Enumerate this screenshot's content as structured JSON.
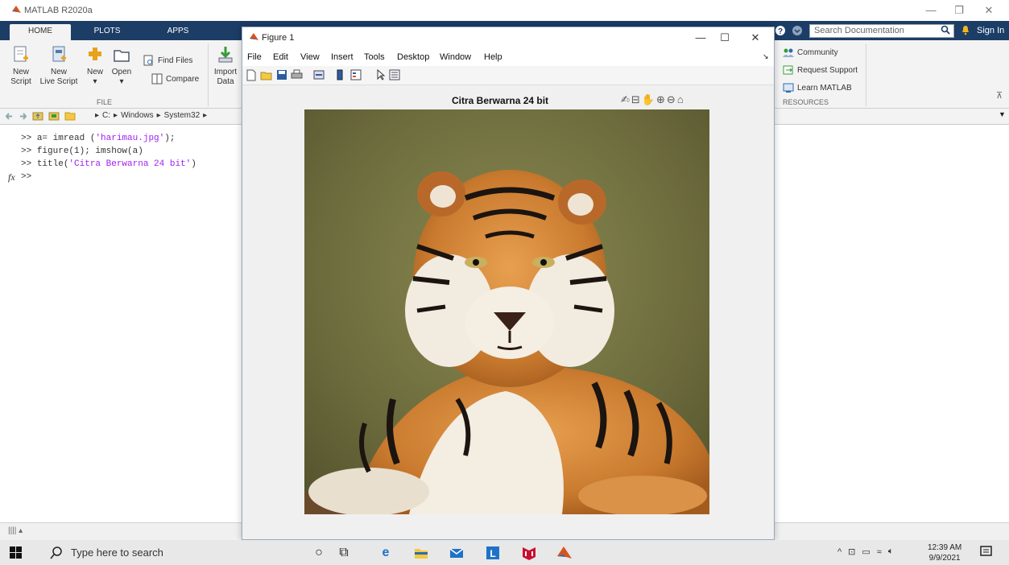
{
  "app": {
    "title": "MATLAB R2020a",
    "window_controls": {
      "minimize": "—",
      "restore": "❐",
      "close": "✕"
    }
  },
  "tabs": [
    {
      "label": "HOME",
      "active": true
    },
    {
      "label": "PLOTS",
      "active": false
    },
    {
      "label": "APPS",
      "active": false
    }
  ],
  "search": {
    "placeholder": "Search Documentation"
  },
  "sign_in": "Sign In",
  "ribbon": {
    "new_script": [
      "New",
      "Script"
    ],
    "new_live_script": [
      "New",
      "Live Script"
    ],
    "new": "New",
    "open": "Open",
    "find_files": "Find Files",
    "compare": "Compare",
    "import_data": [
      "Import",
      "Data"
    ],
    "file_group": "FILE",
    "community": "Community",
    "request_support": "Request Support",
    "learn_matlab": "Learn MATLAB",
    "resources_group": "RESOURCES"
  },
  "address": {
    "path": [
      "C:",
      "Windows",
      "System32"
    ]
  },
  "command_window": {
    "lines": [
      {
        "prompt": ">> ",
        "code": "a= imread (",
        "str": "'harimau.jpg'",
        "tail": ");"
      },
      {
        "prompt": ">> ",
        "code": "figure(1); imshow(a)",
        "str": "",
        "tail": ""
      },
      {
        "prompt": ">> ",
        "code": "title(",
        "str": "'Citra Berwarna 24 bit'",
        "tail": ")"
      }
    ],
    "fx_prompt": ">>"
  },
  "figure": {
    "title": "Figure 1",
    "menu": [
      "File",
      "Edit",
      "View",
      "Insert",
      "Tools",
      "Desktop",
      "Window",
      "Help"
    ],
    "axes_title": "Citra Berwarna 24 bit",
    "image_alt": "tiger"
  },
  "taskbar": {
    "search_placeholder": "Type here to search",
    "time": "12:39 AM",
    "date": "9/9/2021"
  },
  "colors": {
    "tabstrip": "#1c3d66",
    "string_purple": "#a020f0",
    "matlab_orange": "#d9531e"
  }
}
